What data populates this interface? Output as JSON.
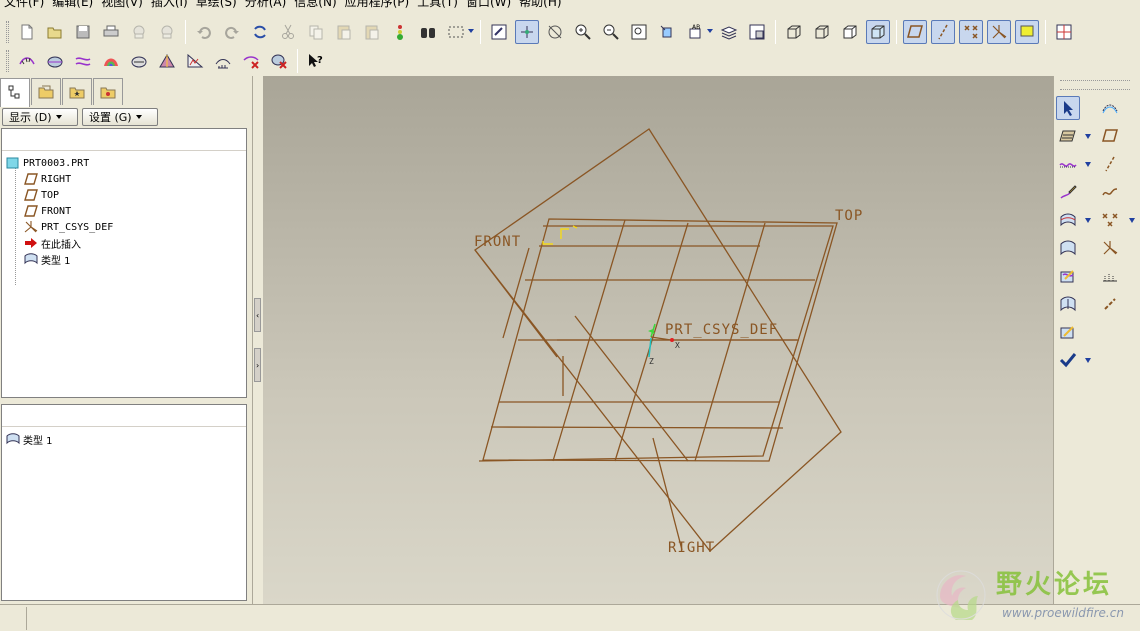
{
  "menubar": {
    "items": [
      "文件(F)",
      "编辑(E)",
      "视图(V)",
      "插入(I)",
      "草绘(S)",
      "分析(A)",
      "信息(N)",
      "应用程序(P)",
      "工具(T)",
      "窗口(W)",
      "帮助(H)"
    ]
  },
  "toolbar1": {
    "icons": [
      "new-icon",
      "open-icon",
      "save-icon",
      "print-icon",
      "email-icon",
      "email-link-icon",
      "undo-icon",
      "redo-icon",
      "regenerate-icon",
      "cut-icon",
      "copy-icon",
      "paste-icon",
      "paste-special-icon",
      "traffic-light-icon",
      "binoculars-icon",
      "select-box-icon",
      "repaint-icon",
      "spin-center-icon",
      "orient-mode-icon",
      "zoom-in-icon",
      "zoom-out-icon",
      "refit-icon",
      "reorient-icon",
      "saved-views-icon",
      "layers-icon",
      "view-manager-icon",
      "wireframe-icon",
      "hidden-line-icon",
      "no-hidden-icon",
      "shading-icon",
      "datum-plane-display-icon",
      "datum-axis-display-icon",
      "datum-point-display-icon",
      "csys-display-icon",
      "annotation-display-icon",
      "model-tree-toggle-icon"
    ]
  },
  "toolbar2": {
    "icons": [
      "curvature-icon",
      "section-icon",
      "offset-icon",
      "shaded-curvature-icon",
      "draft-icon",
      "reflection-icon",
      "dihedral-icon",
      "curve-deviation-icon",
      "delete-analysis-icon",
      "hide-analysis-icon",
      "context-help-icon"
    ]
  },
  "navigator": {
    "tabs": [
      "model-tree-tab",
      "folder-browser-tab",
      "favorites-tab",
      "connections-tab"
    ],
    "display_button": "显示 (D)",
    "settings_button": "设置 (G)",
    "tree": {
      "root": "PRT0003.PRT",
      "items": [
        {
          "label": "RIGHT",
          "icon": "datum-plane-icon"
        },
        {
          "label": "TOP",
          "icon": "datum-plane-icon"
        },
        {
          "label": "FRONT",
          "icon": "datum-plane-icon"
        },
        {
          "label": "PRT_CSYS_DEF",
          "icon": "csys-icon"
        },
        {
          "label": "在此插入",
          "icon": "insert-here-arrow-icon"
        },
        {
          "label": "类型 1",
          "icon": "style-feature-icon"
        }
      ]
    },
    "layer_panel": {
      "item": "类型 1"
    }
  },
  "graphics": {
    "labels": {
      "front": "FRONT",
      "top": "TOP",
      "right": "RIGHT",
      "csys": "PRT_CSYS_DEF",
      "csys_x": "X",
      "csys_z": "Z"
    },
    "line_color": "#8a5624"
  },
  "right_toolbar": {
    "icons": [
      "select-arrow-icon",
      "trace-curve-icon",
      "internal-plane-icon",
      "datum-plane-tool-icon",
      "curve-icon",
      "datum-axis-tool-icon",
      "draw-curve-icon",
      "curve-tool-icon",
      "surface-icon",
      "datum-point-tool-icon",
      "surface-edit-icon",
      "csys-tool-icon",
      "curve-edit-icon",
      "analysis-icon",
      "surface-connect-icon",
      "link-icon",
      "trim-icon",
      "done-check-icon"
    ]
  },
  "watermark": {
    "text": "野火论坛",
    "url": "www.proewildfire.cn"
  }
}
